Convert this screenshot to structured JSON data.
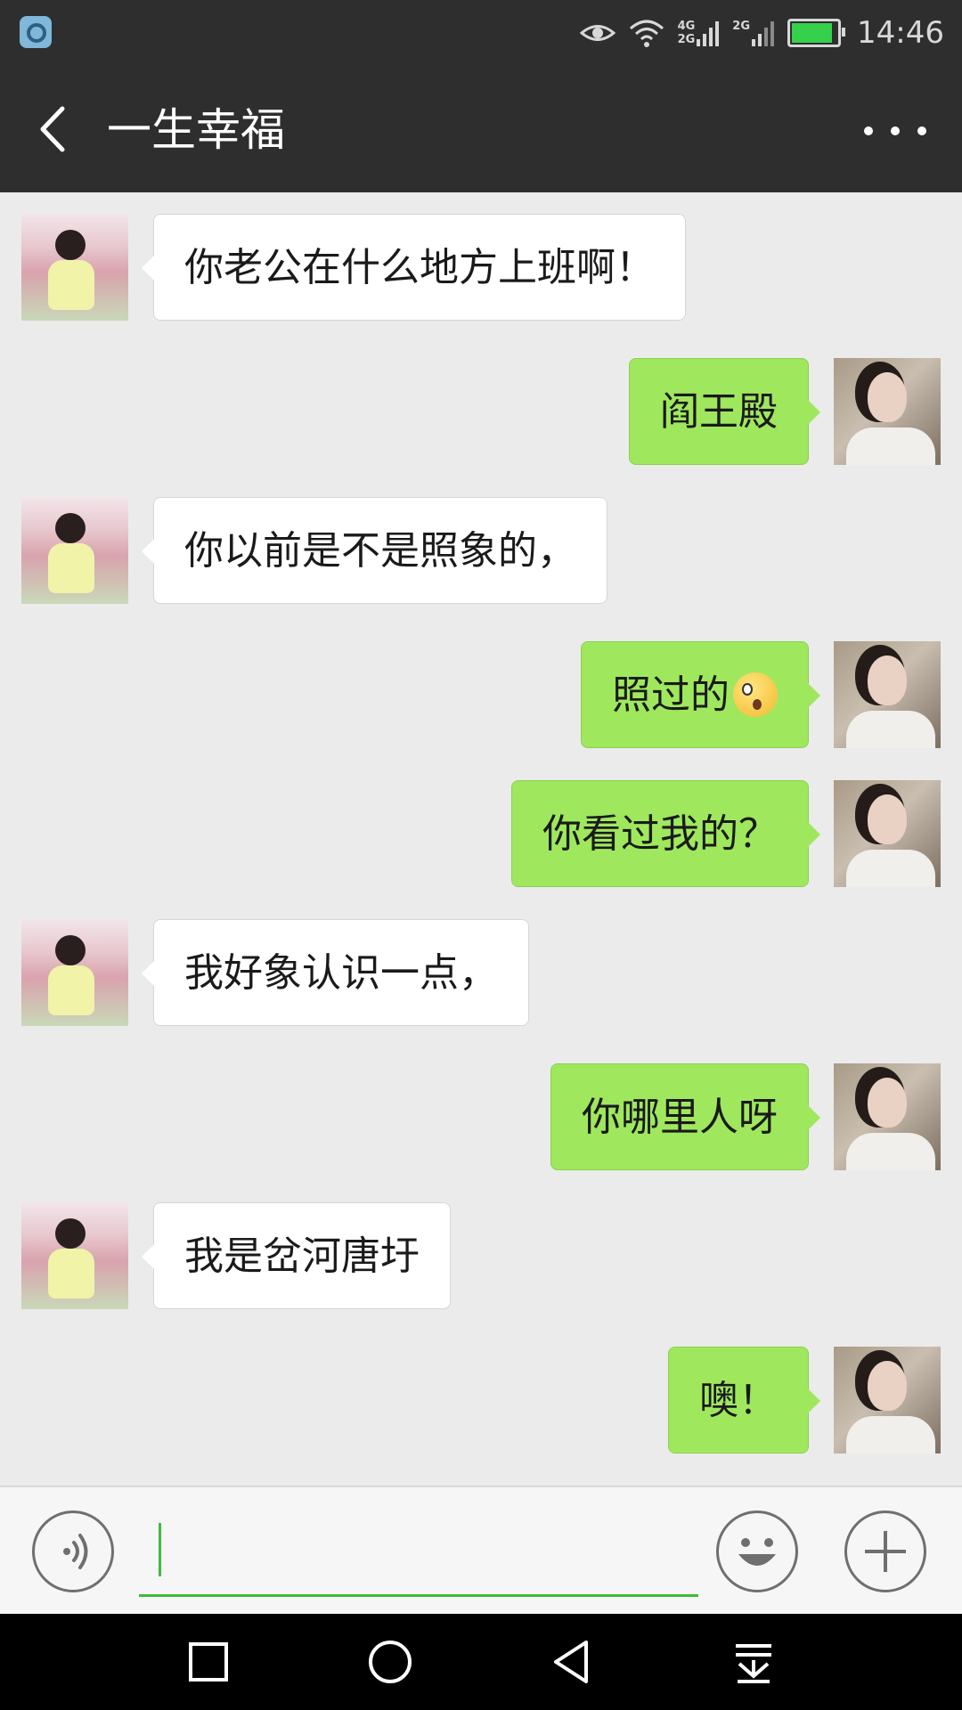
{
  "status_bar": {
    "time": "14:46",
    "network_labels": [
      "4G",
      "2G",
      "2G"
    ],
    "icons": [
      "app-icon",
      "eye-icon",
      "wifi-icon",
      "signal-icon",
      "signal-icon",
      "battery-icon"
    ],
    "battery_level": 0.84,
    "battery_color": "#35d04c"
  },
  "header": {
    "title": "一生幸福",
    "back_icon": "chevron-left-icon",
    "more_icon": "more-dots-icon"
  },
  "messages": [
    {
      "side": "left",
      "avatar": "child-avatar",
      "text": "你老公在什么地方上班啊！"
    },
    {
      "side": "right",
      "avatar": "woman-avatar",
      "text": "阎王殿"
    },
    {
      "side": "left",
      "avatar": "child-avatar",
      "text": "你以前是不是照象的，"
    },
    {
      "side": "right",
      "avatar": "woman-avatar",
      "text": "照过的",
      "emoji": "surprised-face-emoji"
    },
    {
      "side": "right",
      "avatar": "woman-avatar",
      "text": "你看过我的？"
    },
    {
      "side": "left",
      "avatar": "child-avatar",
      "text": "我好象认识一点，"
    },
    {
      "side": "right",
      "avatar": "woman-avatar",
      "text": "你哪里人呀"
    },
    {
      "side": "left",
      "avatar": "child-avatar",
      "text": "我是岔河唐圩"
    },
    {
      "side": "right",
      "avatar": "woman-avatar",
      "text": "噢！"
    }
  ],
  "input_bar": {
    "value": "",
    "icons": [
      "voice-icon",
      "emoji-icon",
      "plus-icon"
    ]
  },
  "nav_bar": {
    "icons": [
      "recents-square-icon",
      "home-circle-icon",
      "back-triangle-icon",
      "notification-pull-icon"
    ]
  },
  "colors": {
    "header_bg": "#2e2e2e",
    "chat_bg": "#ebebeb",
    "sent_bubble": "#9fe85e",
    "received_bubble": "#ffffff",
    "accent_green": "#3dbb3d"
  }
}
